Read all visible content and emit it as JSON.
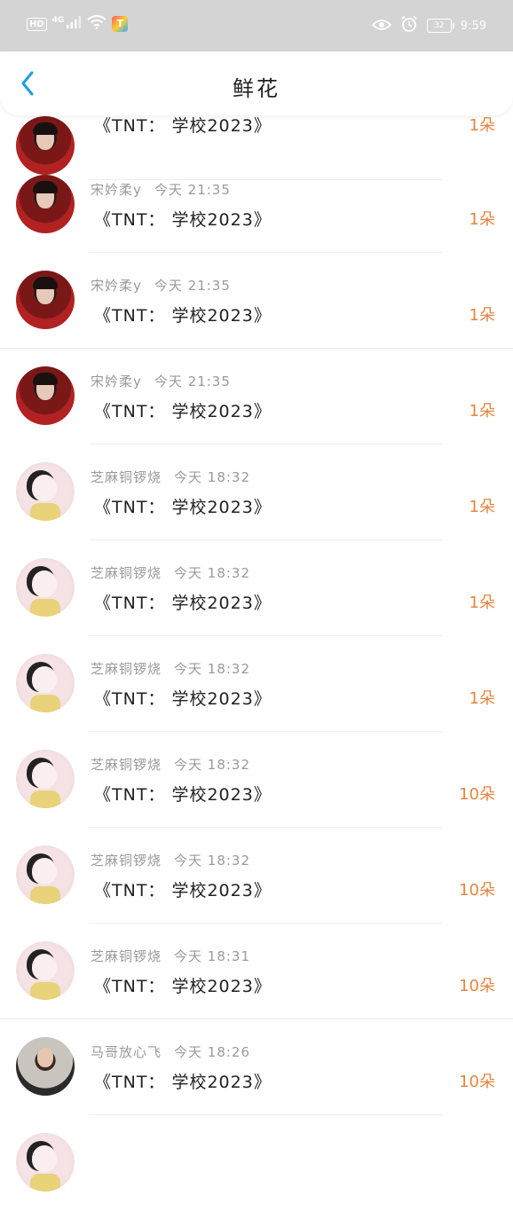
{
  "status_bar": {
    "hd_label": "HD",
    "network_label": "4G",
    "app_badge": "T",
    "battery_text": "32",
    "time": "9:59",
    "icons": [
      "signal-icon",
      "wifi-icon",
      "eye-icon",
      "alarm-icon",
      "battery-icon"
    ]
  },
  "header": {
    "title": "鲜花",
    "back_icon": "chevron-left-icon",
    "accent_color": "#1f9be8"
  },
  "items": [
    {
      "user": "",
      "time": "",
      "title": "《TNT： 学校2023》",
      "count": "1朵",
      "avatar": "dark"
    },
    {
      "user": "宋妗柔y",
      "time": "今天 21:35",
      "title": "《TNT： 学校2023》",
      "count": "1朵",
      "avatar": "dark"
    },
    {
      "user": "宋妗柔y",
      "time": "今天 21:35",
      "title": "《TNT： 学校2023》",
      "count": "1朵",
      "avatar": "dark"
    },
    {
      "user": "宋妗柔y",
      "time": "今天 21:35",
      "title": "《TNT： 学校2023》",
      "count": "1朵",
      "avatar": "dark"
    },
    {
      "user": "芝麻铜锣烧",
      "time": "今天 18:32",
      "title": "《TNT： 学校2023》",
      "count": "1朵",
      "avatar": "pink"
    },
    {
      "user": "芝麻铜锣烧",
      "time": "今天 18:32",
      "title": "《TNT： 学校2023》",
      "count": "1朵",
      "avatar": "pink"
    },
    {
      "user": "芝麻铜锣烧",
      "time": "今天 18:32",
      "title": "《TNT： 学校2023》",
      "count": "1朵",
      "avatar": "pink"
    },
    {
      "user": "芝麻铜锣烧",
      "time": "今天 18:32",
      "title": "《TNT： 学校2023》",
      "count": "10朵",
      "avatar": "pink"
    },
    {
      "user": "芝麻铜锣烧",
      "time": "今天 18:32",
      "title": "《TNT： 学校2023》",
      "count": "10朵",
      "avatar": "pink"
    },
    {
      "user": "芝麻铜锣烧",
      "time": "今天 18:31",
      "title": "《TNT： 学校2023》",
      "count": "10朵",
      "avatar": "pink"
    },
    {
      "user": "马哥放心飞",
      "time": "今天 18:26",
      "title": "《TNT： 学校2023》",
      "count": "10朵",
      "avatar": "suit"
    }
  ],
  "colors": {
    "status_bar_bg": "#d4d4d4",
    "count_color": "#e8843f",
    "meta_color": "#9a9a9a"
  }
}
